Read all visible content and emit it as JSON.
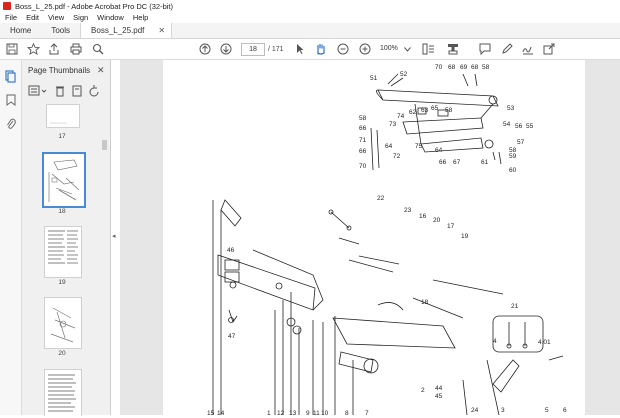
{
  "window": {
    "title": "Boss_L_25.pdf - Adobe Acrobat Pro DC (32-bit)"
  },
  "menu": [
    "File",
    "Edit",
    "View",
    "Sign",
    "Window",
    "Help"
  ],
  "tabs": {
    "home": "Home",
    "tools": "Tools",
    "document": "Boss_L_25.pdf"
  },
  "toolbar": {
    "page_current": "18",
    "page_total": "/ 171",
    "zoom": "100%"
  },
  "panel": {
    "title": "Page Thumbnails",
    "thumbnails": [
      {
        "label": "17"
      },
      {
        "label": "18",
        "selected": true
      },
      {
        "label": "19"
      },
      {
        "label": "20"
      }
    ]
  },
  "drawing": {
    "callouts_top": [
      "70",
      "68",
      "69",
      "68",
      "58",
      "51",
      "52",
      "53",
      "58",
      "66",
      "71",
      "66",
      "70",
      "74",
      "72",
      "73",
      "62",
      "63",
      "65",
      "64",
      "66",
      "67",
      "75",
      "56",
      "55",
      "57",
      "58",
      "59",
      "61",
      "60",
      "54"
    ],
    "callouts_main": [
      "22",
      "23",
      "16",
      "20",
      "17",
      "19",
      "46",
      "18",
      "21",
      "47",
      "4",
      "4.01",
      "2",
      "44",
      "45",
      "24",
      "3",
      "5",
      "6",
      "1",
      "12",
      "13",
      "9",
      "11",
      "10",
      "8",
      "7",
      "15",
      "14"
    ]
  },
  "colors": {
    "accent": "#4a8ad4",
    "app_red": "#d9271e"
  }
}
